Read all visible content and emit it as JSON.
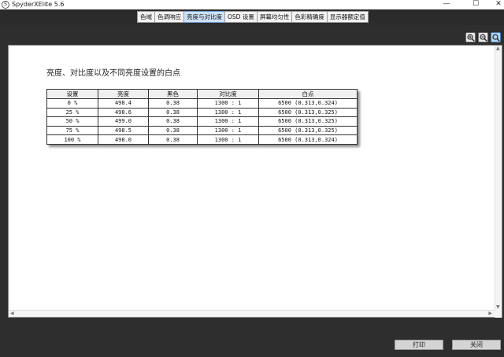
{
  "window": {
    "title": "SpyderXElite 5.6",
    "icon_glyph": "S",
    "minimize_glyph": "—",
    "maximize_glyph": "☐",
    "close_glyph": "✕"
  },
  "tabs": [
    {
      "label": "色域"
    },
    {
      "label": "色调响应"
    },
    {
      "label": "亮度与对比度",
      "active": true
    },
    {
      "label": "OSD 设置"
    },
    {
      "label": "屏幕均匀性"
    },
    {
      "label": "色彩精确度"
    },
    {
      "label": "显示器额定值"
    }
  ],
  "zoom_icons": [
    "zoom-in-icon",
    "zoom-out-icon",
    "zoom-fit-icon"
  ],
  "content": {
    "title": "亮度、对比度以及不同亮度设置的白点",
    "table": {
      "headers": [
        "设置",
        "亮度",
        "黑色",
        "对比度",
        "白点"
      ],
      "rows": [
        [
          "0 %",
          "498.4",
          "0.38",
          "1300 : 1",
          "6500 (0.313,0.324)"
        ],
        [
          "25 %",
          "498.6",
          "0.38",
          "1300 : 1",
          "6500 (0.313,0.325)"
        ],
        [
          "50 %",
          "499.0",
          "0.38",
          "1300 : 1",
          "6500 (0.313,0.325)"
        ],
        [
          "75 %",
          "498.5",
          "0.38",
          "1300 : 1",
          "6500 (0.313,0.325)"
        ],
        [
          "100 %",
          "498.0",
          "0.38",
          "1300 : 1",
          "6500 (0.313,0.324)"
        ]
      ]
    }
  },
  "buttons": {
    "print": "打印",
    "close": "关闭"
  },
  "colors": {
    "active_tab": "#cfe2f7",
    "background": "#2e2e2e"
  }
}
